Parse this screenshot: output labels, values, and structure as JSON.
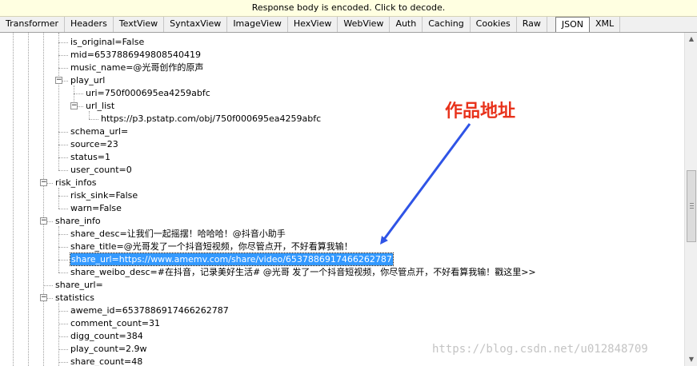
{
  "banner": {
    "text": "Response body is encoded. Click to decode."
  },
  "tabs": [
    "Transformer",
    "Headers",
    "TextView",
    "SyntaxView",
    "ImageView",
    "HexView",
    "WebView",
    "Auth",
    "Caching",
    "Cookies",
    "Raw",
    "JSON",
    "XML"
  ],
  "selected_tab": "JSON",
  "tree": [
    {
      "text": "is_original=False",
      "depth": 4
    },
    {
      "text": "mid=6537886949808540419",
      "depth": 4
    },
    {
      "text": "music_name=@光哥创作的原声",
      "depth": 4
    },
    {
      "text": "play_url",
      "depth": 4,
      "toggle": "-"
    },
    {
      "text": "uri=750f000695ea4259abfc",
      "depth": 5
    },
    {
      "text": "url_list",
      "depth": 5,
      "toggle": "-"
    },
    {
      "text": "https://p3.pstatp.com/obj/750f000695ea4259abfc",
      "depth": 6
    },
    {
      "text": "schema_url=",
      "depth": 4
    },
    {
      "text": "source=23",
      "depth": 4
    },
    {
      "text": "status=1",
      "depth": 4
    },
    {
      "text": "user_count=0",
      "depth": 4
    },
    {
      "text": "risk_infos",
      "depth": 3,
      "toggle": "-"
    },
    {
      "text": "risk_sink=False",
      "depth": 4
    },
    {
      "text": "warn=False",
      "depth": 4
    },
    {
      "text": "share_info",
      "depth": 3,
      "toggle": "-"
    },
    {
      "text": "share_desc=让我们一起摇摆！哈哈哈！@抖音小助手",
      "depth": 4
    },
    {
      "text": "share_title=@光哥发了一个抖音短视频，你尽管点开，不好看算我输！",
      "depth": 4
    },
    {
      "text": "share_url=https://www.amemv.com/share/video/6537886917466262787",
      "depth": 4,
      "selected": true
    },
    {
      "text": "share_weibo_desc=#在抖音，记录美好生活# @光哥 发了一个抖音短视频，你尽管点开，不好看算我输！戳这里>>",
      "depth": 4
    },
    {
      "text": "share_url=",
      "depth": 3
    },
    {
      "text": "statistics",
      "depth": 3,
      "toggle": "-"
    },
    {
      "text": "aweme_id=6537886917466262787",
      "depth": 4
    },
    {
      "text": "comment_count=31",
      "depth": 4
    },
    {
      "text": "digg_count=384",
      "depth": 4
    },
    {
      "text": "play_count=2.9w",
      "depth": 4
    },
    {
      "text": "share_count=48",
      "depth": 4
    }
  ],
  "annotation": {
    "text": "作品地址",
    "color": "#e8331c"
  },
  "watermark": {
    "text": "https://blog.csdn.net/u012848709"
  },
  "colors": {
    "selection": "#3399ff",
    "arrow": "#2f54e6",
    "banner": "#ffffe1"
  }
}
